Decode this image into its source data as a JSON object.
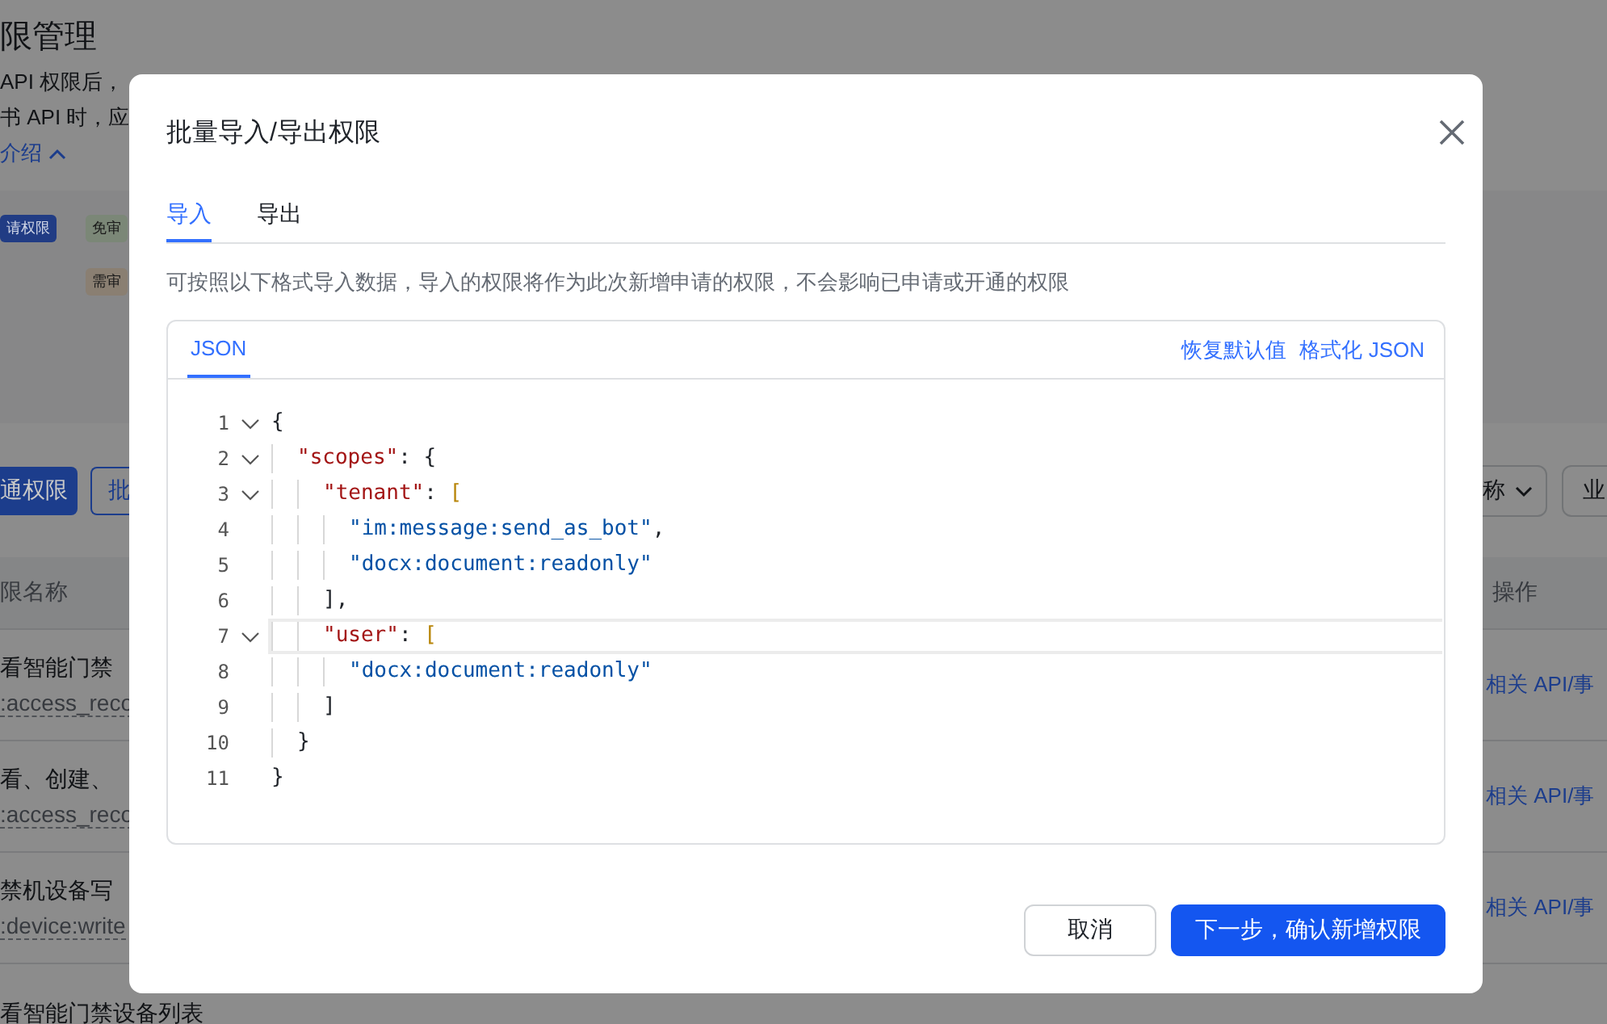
{
  "page": {
    "title": "限管理",
    "intro_lines": [
      "API 权限后，",
      "书 API 时，应"
    ],
    "intro_toggle": {
      "label": "介绍",
      "expanded": true
    },
    "flow_chips": [
      {
        "label": "请权限",
        "color": "#213c84"
      },
      {
        "label": "免审",
        "color": "#7b8777"
      },
      {
        "label": "需审",
        "color": "#8a7f72"
      }
    ],
    "toolbar": {
      "primary_button": "通权限",
      "secondary_button": "批",
      "filters": [
        "称",
        "业"
      ]
    },
    "table": {
      "columns": [
        {
          "label": "限名称"
        },
        {
          "label": "操作"
        }
      ],
      "rows": [
        {
          "name": "看智能门禁",
          "scope": ":access_reco",
          "action": "相关 API/事"
        },
        {
          "name": "看、创建、",
          "scope": ":access_reco",
          "action": "相关 API/事"
        },
        {
          "name": "禁机设备写",
          "scope": ":device:write",
          "action": "相关 API/事"
        },
        {
          "name": "看智能门禁设备列表"
        }
      ]
    }
  },
  "dialog": {
    "title": "批量导入/导出权限",
    "tabs": [
      {
        "label": "导入",
        "selected": true
      },
      {
        "label": "导出",
        "selected": false
      }
    ],
    "description": "可按照以下格式导入数据，导入的权限将作为此次新增申请的权限，不会影响已申请或开通的权限",
    "editor": {
      "tabs": [
        {
          "label": "JSON",
          "selected": true
        }
      ],
      "actions": [
        "恢复默认值",
        "格式化 JSON"
      ],
      "lines": [
        {
          "number": "1",
          "foldable": true,
          "active": false,
          "tokens": [
            {
              "kind": "brace-open",
              "text": "{"
            }
          ]
        },
        {
          "number": "2",
          "foldable": true,
          "active": false,
          "tokens": [
            {
              "kind": "key",
              "text": "\"scopes\""
            },
            {
              "kind": "punct",
              "text": ": "
            },
            {
              "kind": "brace-open",
              "text": "{"
            }
          ]
        },
        {
          "number": "3",
          "foldable": true,
          "active": false,
          "tokens": [
            {
              "kind": "key",
              "text": "\"tenant\""
            },
            {
              "kind": "punct",
              "text": ": "
            },
            {
              "kind": "array-open",
              "text": "["
            }
          ]
        },
        {
          "number": "4",
          "foldable": false,
          "active": false,
          "tokens": [
            {
              "kind": "string",
              "text": "\"im:message:send_as_bot\""
            },
            {
              "kind": "punct",
              "text": ","
            }
          ]
        },
        {
          "number": "5",
          "foldable": false,
          "active": false,
          "tokens": [
            {
              "kind": "string",
              "text": "\"docx:document:readonly\""
            }
          ]
        },
        {
          "number": "6",
          "foldable": false,
          "active": false,
          "tokens": [
            {
              "kind": "array-close",
              "text": "]"
            },
            {
              "kind": "punct",
              "text": ","
            }
          ]
        },
        {
          "number": "7",
          "foldable": true,
          "active": true,
          "tokens": [
            {
              "kind": "key",
              "text": "\"user\""
            },
            {
              "kind": "punct",
              "text": ": "
            },
            {
              "kind": "array-open",
              "text": "["
            }
          ]
        },
        {
          "number": "8",
          "foldable": false,
          "active": false,
          "tokens": [
            {
              "kind": "string",
              "text": "\"docx:document:readonly\""
            }
          ]
        },
        {
          "number": "9",
          "foldable": false,
          "active": false,
          "tokens": [
            {
              "kind": "array-close",
              "text": "]"
            }
          ]
        },
        {
          "number": "10",
          "foldable": false,
          "active": false,
          "tokens": [
            {
              "kind": "brace-close",
              "text": "}"
            }
          ]
        },
        {
          "number": "11",
          "foldable": false,
          "active": false,
          "tokens": [
            {
              "kind": "brace-close",
              "text": "}"
            }
          ]
        }
      ]
    },
    "buttons": [
      {
        "label": "取消",
        "kind": "secondary"
      },
      {
        "label": "下一步，确认新增权限",
        "kind": "primary"
      }
    ]
  }
}
